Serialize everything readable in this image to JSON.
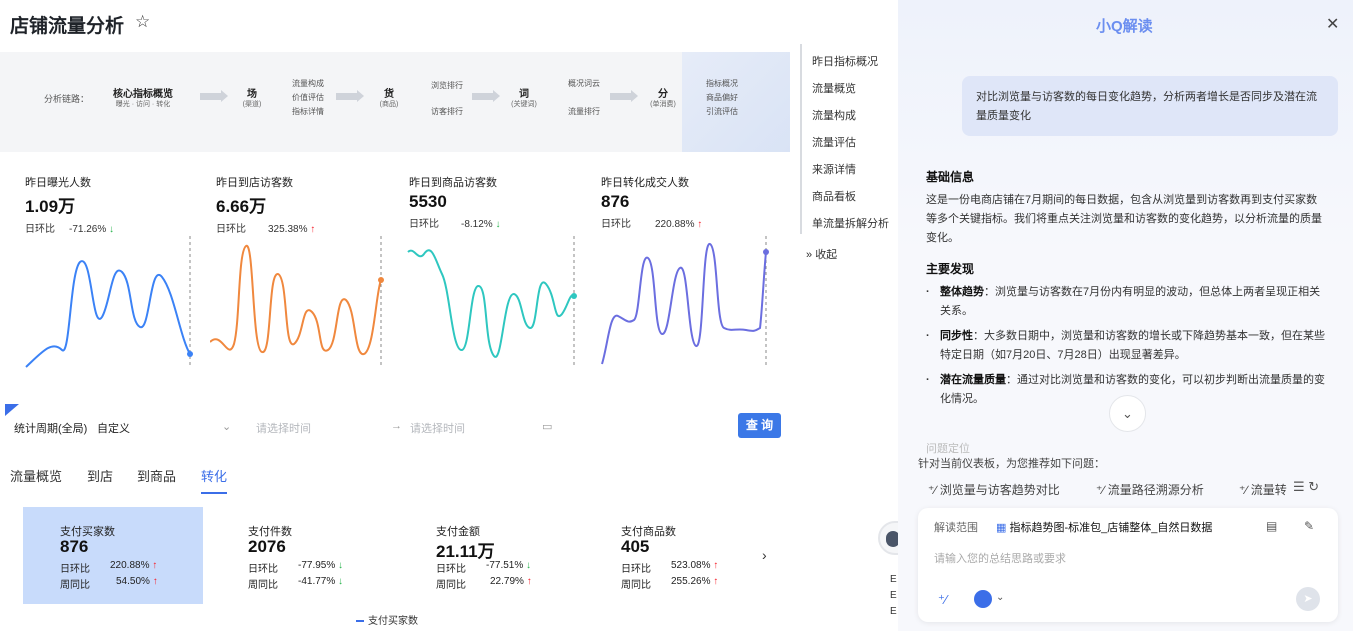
{
  "page_title": "店铺流量分析",
  "flow": {
    "prefix": "分析链路：",
    "core_title": "核心指标概览",
    "core_sub": "曝光 · 访问 · 转化",
    "steps": [
      {
        "title": "场",
        "sub": "(渠道)",
        "items": [
          "流量构成",
          "价值评估",
          "指标详情"
        ]
      },
      {
        "title": "货",
        "sub": "(商品)",
        "items": [
          "浏览排行",
          "访客排行"
        ]
      },
      {
        "title": "词",
        "sub": "(关键词)",
        "items": [
          "概况词云",
          "流量排行"
        ]
      },
      {
        "title": "分",
        "sub": "(单消费)",
        "items": [
          "指标概况",
          "商品偏好",
          "引流评估"
        ]
      }
    ]
  },
  "right_nav": [
    "昨日指标概况",
    "流量概览",
    "流量构成",
    "流量评估",
    "来源详情",
    "商品看板",
    "单流量拆解分析"
  ],
  "collapse_label": "收起",
  "metrics": [
    {
      "label": "昨日曝光人数",
      "value": "1.09万",
      "cmp_label": "日环比",
      "cmp_value": "-71.26%",
      "dir": "down",
      "color": "#3b82f6"
    },
    {
      "label": "昨日到店访客数",
      "value": "6.66万",
      "cmp_label": "日环比",
      "cmp_value": "325.38%",
      "dir": "up",
      "color": "#f0883e"
    },
    {
      "label": "昨日到商品访客数",
      "value": "5530",
      "cmp_label": "日环比",
      "cmp_value": "-8.12%",
      "dir": "down",
      "color": "#2ec7c0"
    },
    {
      "label": "昨日转化成交人数",
      "value": "876",
      "cmp_label": "日环比",
      "cmp_value": "220.88%",
      "dir": "up",
      "color": "#6b6ee0"
    }
  ],
  "filter": {
    "period_label": "统计周期(全局)",
    "period_value": "自定义",
    "start_placeholder": "请选择时间",
    "end_placeholder": "请选择时间",
    "query_label": "查 询"
  },
  "tabs": [
    "流量概览",
    "到店",
    "到商品",
    "转化"
  ],
  "active_tab": "转化",
  "cards": [
    {
      "label": "支付买家数",
      "value": "876",
      "r1_label": "日环比",
      "r1_value": "220.88%",
      "r1_dir": "up",
      "r2_label": "周同比",
      "r2_value": "54.50%",
      "r2_dir": "up"
    },
    {
      "label": "支付件数",
      "value": "2076",
      "r1_label": "日环比",
      "r1_value": "-77.95%",
      "r1_dir": "down",
      "r2_label": "周同比",
      "r2_value": "-41.77%",
      "r2_dir": "down"
    },
    {
      "label": "支付金额",
      "value": "21.11万",
      "r1_label": "日环比",
      "r1_value": "-77.51%",
      "r1_dir": "down",
      "r2_label": "周同比",
      "r2_value": "22.79%",
      "r2_dir": "up"
    },
    {
      "label": "支付商品数",
      "value": "405",
      "r1_label": "日环比",
      "r1_value": "523.08%",
      "r1_dir": "up",
      "r2_label": "周同比",
      "r2_value": "255.26%",
      "r2_dir": "up"
    }
  ],
  "legend_label": "支付买家数",
  "avatar_lines": [
    "E",
    "E",
    "E"
  ],
  "panel": {
    "title": "小Q解读",
    "question": "对比浏览量与访客数的每日变化趋势，分析两者增长是否同步及潜在流量质量变化",
    "basic_title": "基础信息",
    "basic_text": "这是一份电商店铺在7月期间的每日数据，包含从浏览量到访客数再到支付买家数等多个关键指标。我们将重点关注浏览量和访客数的变化趋势，以分析流量的质量变化。",
    "findings_title": "主要发现",
    "findings": [
      {
        "key": "整体趋势",
        "text": "：浏览量与访客数在7月份内有明显的波动，但总体上两者呈现正相关关系。"
      },
      {
        "key": "同步性",
        "text": "：大多数日期中，浏览量和访客数的增长或下降趋势基本一致，但在某些特定日期（如7月20日、7月28日）出现显著差异。"
      },
      {
        "key": "潜在流量质量",
        "text": "：通过对比浏览量和访客数的变化，可以初步判断出流量质量的变化情况。"
      }
    ],
    "faded_text": "问题定位",
    "suggest_title": "针对当前仪表板，为您推荐如下问题：",
    "suggestions": [
      "浏览量与访客趋势对比",
      "流量路径溯源分析",
      "流量转"
    ],
    "scope_label": "解读范围",
    "scope_value": "指标趋势图-标准包_店铺整体_自然日数据",
    "input_placeholder": "请输入您的总结思路或要求"
  }
}
